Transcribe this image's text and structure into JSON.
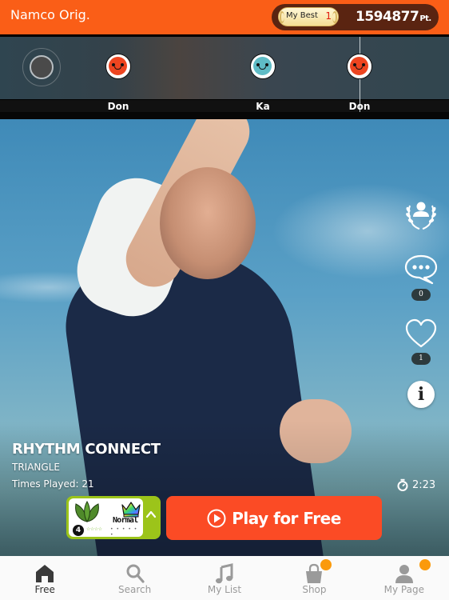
{
  "header": {
    "title": "Namco Orig.",
    "my_best_label": "My Best",
    "my_best_rank": "1",
    "score": "1594877",
    "score_unit": "Pt."
  },
  "note_lane": {
    "notes": [
      {
        "type": "don",
        "label": "Don"
      },
      {
        "type": "ka",
        "label": "Ka"
      },
      {
        "type": "don",
        "label": "Don"
      }
    ]
  },
  "side_actions": {
    "comments_count": "0",
    "likes_count": "1",
    "info_label": "i"
  },
  "song": {
    "title": "RHYTHM CONNECT",
    "artist": "TRIANGLE",
    "times_played": "Times Played: 21",
    "duration": "2:23"
  },
  "difficulty": {
    "name": "Normal",
    "level": "4",
    "stars_filled": "☆☆☆☆",
    "stars_empty": "• • • • • •"
  },
  "play_button": {
    "label": "Play for Free"
  },
  "nav": {
    "items": [
      {
        "label": "Free",
        "icon": "home-icon",
        "active": true
      },
      {
        "label": "Search",
        "icon": "search-icon",
        "active": false
      },
      {
        "label": "My List",
        "icon": "music-note-icon",
        "active": false
      },
      {
        "label": "Shop",
        "icon": "shopping-bag-icon",
        "active": false,
        "badge": true
      },
      {
        "label": "My Page",
        "icon": "user-icon",
        "active": false,
        "badge": true
      }
    ]
  },
  "colors": {
    "header": "#fa5e17",
    "score_pill": "#5a2411",
    "play_button": "#fb4b25",
    "difficulty": "#9cc41a",
    "nav_badge": "#fb9a0c",
    "don": "#ee4520",
    "ka": "#5fbcc6"
  }
}
